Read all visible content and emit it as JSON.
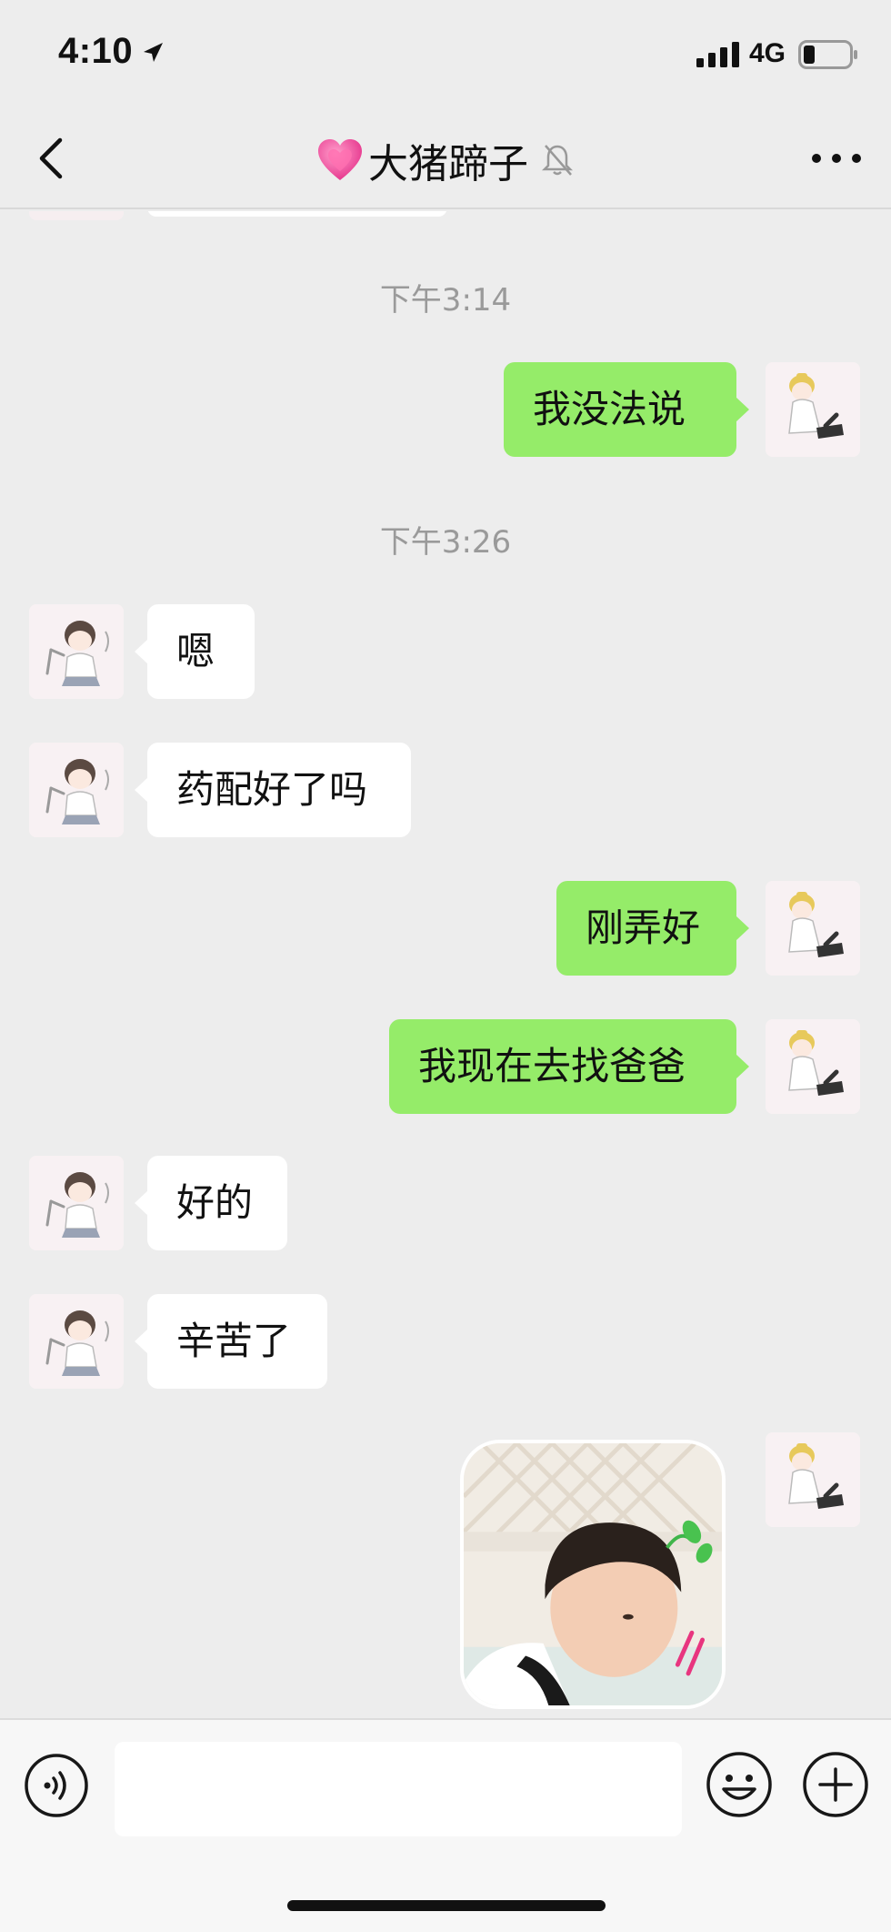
{
  "status_bar": {
    "time": "4:10",
    "network": "4G"
  },
  "header": {
    "title": "大猪蹄子",
    "icons": [
      "back-chevron-icon",
      "pink-heart-icon",
      "muted-bell-icon",
      "more-dots-icon"
    ]
  },
  "messages": [
    {
      "type": "timestamp",
      "text": "下午3:14"
    },
    {
      "type": "text",
      "side": "out",
      "text": "我没法说"
    },
    {
      "type": "timestamp",
      "text": "下午3:26"
    },
    {
      "type": "text",
      "side": "in",
      "text": "嗯"
    },
    {
      "type": "text",
      "side": "in",
      "text": "药配好了吗"
    },
    {
      "type": "text",
      "side": "out",
      "text": "刚弄好"
    },
    {
      "type": "text",
      "side": "out",
      "text": "我现在去找爸爸"
    },
    {
      "type": "text",
      "side": "in",
      "text": "好的"
    },
    {
      "type": "text",
      "side": "in",
      "text": "辛苦了"
    },
    {
      "type": "sticker",
      "side": "out",
      "description": "child-sticker"
    }
  ],
  "input_bar": {
    "placeholder": "",
    "icons": [
      "voice-icon",
      "emoji-icon",
      "plus-icon"
    ]
  },
  "colors": {
    "background": "#ededed",
    "outgoing_bubble": "#95ec69",
    "incoming_bubble": "#ffffff",
    "timestamp_text": "#9a9a9a"
  }
}
